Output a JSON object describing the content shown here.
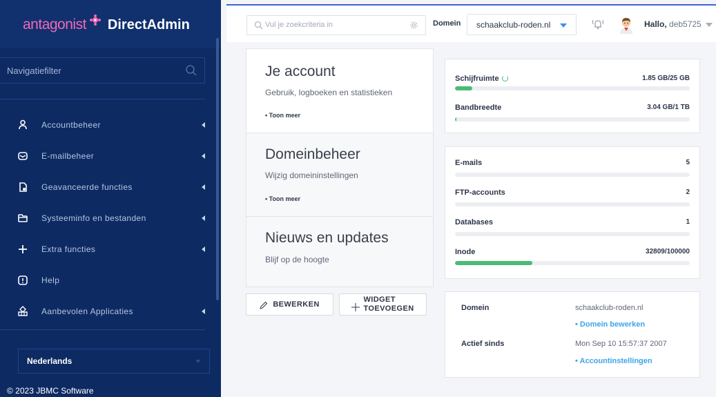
{
  "brand": {
    "logo_part1": "antagonist",
    "logo_part2": "DirectAdmin",
    "accent": "#f06ab4"
  },
  "sidebar": {
    "filter_placeholder": "Navigatiefilter",
    "items": [
      {
        "label": "Accountbeheer",
        "icon": "user-icon",
        "has_submenu": true
      },
      {
        "label": "E-mailbeheer",
        "icon": "mail-icon",
        "has_submenu": true
      },
      {
        "label": "Geavanceerde functies",
        "icon": "advanced-icon",
        "has_submenu": true
      },
      {
        "label": "Systeeminfo en bestanden",
        "icon": "folder-icon",
        "has_submenu": true
      },
      {
        "label": "Extra functies",
        "icon": "plus-icon",
        "has_submenu": true
      },
      {
        "label": "Help",
        "icon": "help-icon",
        "has_submenu": false
      },
      {
        "label": "Aanbevolen Applicaties",
        "icon": "apps-icon",
        "has_submenu": true
      }
    ],
    "language": "Nederlands",
    "copyright": "© 2023 JBMC Software",
    "bg_color": "#0d2a63"
  },
  "header": {
    "search_placeholder": "Vul je zoekcriteria in",
    "domain_label": "Domein",
    "domain_value": "schaakclub-roden.nl",
    "greeting": "Hallo,",
    "username": "deb5725"
  },
  "widgets": [
    {
      "title": "Je account",
      "subtitle": "Gebruik, logboeken en statistieken",
      "more": "• Toon meer"
    },
    {
      "title": "Domeinbeheer",
      "subtitle": "Wijzig domeininstellingen",
      "more": "• Toon meer"
    },
    {
      "title": "Nieuws en updates",
      "subtitle": "Blijf op de hoogte"
    }
  ],
  "buttons": {
    "edit": "BEWERKEN",
    "add_line1": "WIDGET",
    "add_line2": "TOEVOEGEN"
  },
  "usage": {
    "disk": {
      "label": "Schijfruimte",
      "value": "1.85 GB/25 GB",
      "fraction": 0.074
    },
    "bandwidth": {
      "label": "Bandbreedte",
      "value": "3.04 GB/1 TB",
      "fraction": 0.003
    }
  },
  "counts": [
    {
      "label": "E-mails",
      "value": "5",
      "fraction": 0
    },
    {
      "label": "FTP-accounts",
      "value": "2",
      "fraction": 0
    },
    {
      "label": "Databases",
      "value": "1",
      "fraction": 0
    },
    {
      "label": "Inode",
      "value": "32809/100000",
      "fraction": 0.328
    }
  ],
  "info": {
    "domain_label": "Domein",
    "domain_value": "schaakclub-roden.nl",
    "domain_link": "• Domein bewerken",
    "since_label": "Actief sinds",
    "since_value": "Mon Sep 10 15:57:37 2007",
    "settings_link": "• Accountinstellingen"
  },
  "colors": {
    "progress": "#4cbb78",
    "link": "#3da5e6",
    "header_accent": "#3a66d4"
  }
}
